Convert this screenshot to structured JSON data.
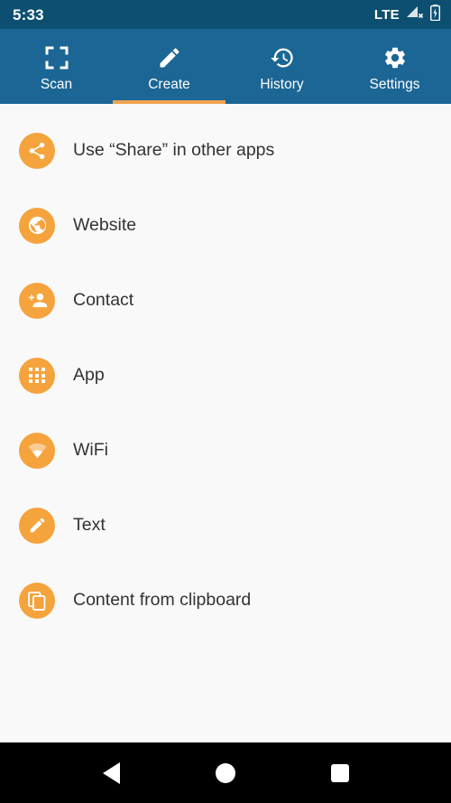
{
  "status_bar": {
    "time": "5:33",
    "network_label": "LTE",
    "signal_icon": "signal-no-service-icon",
    "battery_icon": "battery-charging-icon",
    "background_color": "#0d4f70"
  },
  "tabs": {
    "active_index": 1,
    "indicator_color": "#f0a350",
    "background_color": "#1b6694",
    "items": [
      {
        "label": "Scan",
        "icon": "scan-frame-icon"
      },
      {
        "label": "Create",
        "icon": "pencil-icon"
      },
      {
        "label": "History",
        "icon": "history-clock-icon"
      },
      {
        "label": "Settings",
        "icon": "gear-icon"
      }
    ]
  },
  "list": {
    "accent_color": "#f5a33c",
    "items": [
      {
        "label": "Use “Share” in other apps",
        "icon": "share-icon"
      },
      {
        "label": "Website",
        "icon": "globe-icon"
      },
      {
        "label": "Contact",
        "icon": "add-person-icon"
      },
      {
        "label": "App",
        "icon": "apps-grid-icon"
      },
      {
        "label": "WiFi",
        "icon": "wifi-icon"
      },
      {
        "label": "Text",
        "icon": "pencil-icon"
      },
      {
        "label": "Content from clipboard",
        "icon": "copy-clipboard-icon"
      }
    ]
  },
  "nav_bar": {
    "back_label": "Back",
    "home_label": "Home",
    "recents_label": "Recents"
  }
}
